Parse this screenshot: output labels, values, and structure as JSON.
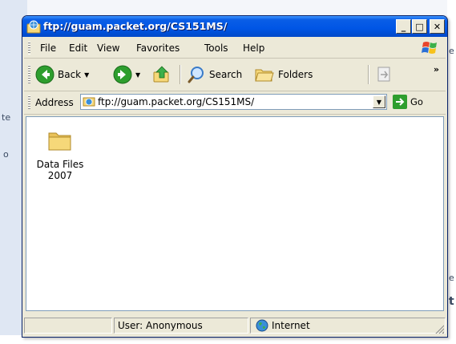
{
  "window": {
    "title": "ftp://guam.packet.org/CS151MS/",
    "minimize_label": "_",
    "maximize_label": "□",
    "close_label": "✕"
  },
  "menubar": {
    "items": [
      "File",
      "Edit",
      "View",
      "Favorites",
      "Tools",
      "Help"
    ]
  },
  "toolbar": {
    "back_label": "Back",
    "search_label": "Search",
    "folders_label": "Folders",
    "more_label": "»"
  },
  "address": {
    "label": "Address",
    "value": "ftp://guam.packet.org/CS151MS/",
    "go_label": "Go"
  },
  "files": [
    {
      "name": "Data Files 2007",
      "icon": "folder-icon"
    }
  ],
  "statusbar": {
    "user": "User: Anonymous",
    "zone": "Internet"
  },
  "colors": {
    "titlebar": "#0055e5",
    "chrome": "#ece9d8",
    "back_green": "#2e9e2e",
    "folder_yellow": "#f6d879"
  },
  "background": {
    "fragments": [
      "te",
      "o",
      "e",
      "t",
      "e"
    ]
  }
}
